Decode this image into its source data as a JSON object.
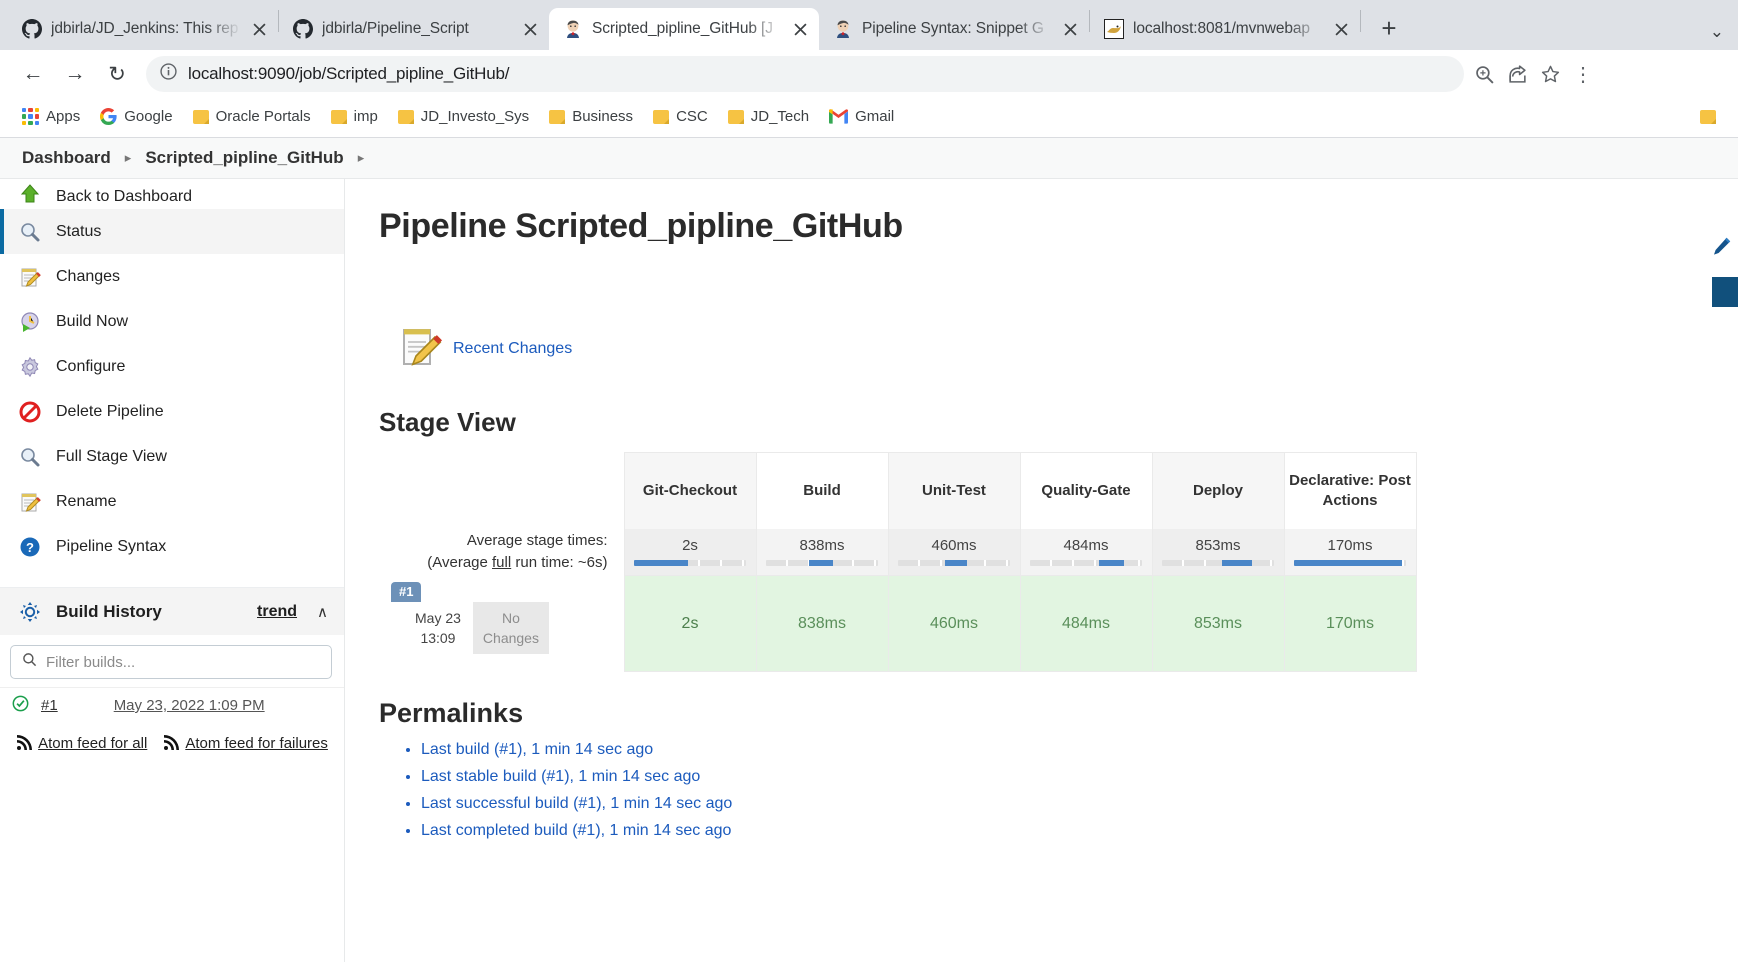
{
  "browser": {
    "tabs": [
      {
        "title": "jdbirla/JD_Jenkins: This rep",
        "favicon": "github-icon",
        "active": false
      },
      {
        "title": "jdbirla/Pipeline_Script",
        "favicon": "github-icon",
        "active": false
      },
      {
        "title": "Scripted_pipline_GitHub [J",
        "favicon": "jenkins-icon",
        "active": true
      },
      {
        "title": "Pipeline Syntax: Snippet G",
        "favicon": "jenkins-icon",
        "active": false
      },
      {
        "title": "localhost:8081/mvnwebap",
        "favicon": "tomcat-icon",
        "active": false
      }
    ],
    "new_tab_label": "+",
    "tab_list_caret": "⌄",
    "nav": {
      "back": "←",
      "forward": "→",
      "reload": "↻"
    },
    "omnibox": {
      "url": "localhost:9090/job/Scripted_pipline_GitHub/",
      "info_icon": "info-circle-icon",
      "zoom_icon": "zoom-search-icon",
      "share_icon": "share-icon",
      "star_icon": "bookmark-star-icon",
      "menu_icon": "kebab-menu-icon"
    },
    "bookmarks": [
      {
        "label": "Apps",
        "icon": "apps-grid-icon"
      },
      {
        "label": "Google",
        "icon": "google-g-icon"
      },
      {
        "label": "Oracle Portals",
        "icon": "folder-icon"
      },
      {
        "label": "imp",
        "icon": "folder-icon"
      },
      {
        "label": "JD_Investo_Sys",
        "icon": "folder-icon"
      },
      {
        "label": "Business",
        "icon": "folder-icon"
      },
      {
        "label": "CSC",
        "icon": "folder-icon"
      },
      {
        "label": "JD_Tech",
        "icon": "folder-icon"
      },
      {
        "label": "Gmail",
        "icon": "gmail-icon"
      }
    ]
  },
  "breadcrumb": {
    "items": [
      "Dashboard",
      "Scripted_pipline_GitHub"
    ],
    "separator": "▸",
    "trailing": "▸"
  },
  "sidebar": {
    "items": [
      {
        "label": "Back to Dashboard",
        "icon": "up-arrow-icon",
        "selected": false
      },
      {
        "label": "Status",
        "icon": "magnifier-icon",
        "selected": true
      },
      {
        "label": "Changes",
        "icon": "notepad-pencil-icon",
        "selected": false
      },
      {
        "label": "Build Now",
        "icon": "build-clock-icon",
        "selected": false
      },
      {
        "label": "Configure",
        "icon": "gear-icon",
        "selected": false
      },
      {
        "label": "Delete Pipeline",
        "icon": "no-entry-icon",
        "selected": false
      },
      {
        "label": "Full Stage View",
        "icon": "magnifier-icon",
        "selected": false
      },
      {
        "label": "Rename",
        "icon": "notepad-pencil-icon",
        "selected": false
      },
      {
        "label": "Pipeline Syntax",
        "icon": "help-question-icon",
        "selected": false
      }
    ],
    "build_history": {
      "title": "Build History",
      "icon": "build-history-icon",
      "trend_label": "trend",
      "collapse_caret": "∧",
      "filter_placeholder": "Filter builds...",
      "filter_value": "",
      "search_icon": "search-icon",
      "builds": [
        {
          "status_icon": "success-check-icon",
          "number": "#1",
          "date": "May 23, 2022 1:09 PM"
        }
      ],
      "feeds": [
        {
          "label": "Atom feed for all",
          "icon": "rss-icon"
        },
        {
          "label": "Atom feed for failures",
          "icon": "rss-icon"
        }
      ]
    }
  },
  "main": {
    "page_title": "Pipeline Scripted_pipline_GitHub",
    "recent_changes": {
      "label": "Recent Changes",
      "icon": "notepad-pencil-icon"
    },
    "stage_view_heading": "Stage View",
    "avg_label_line1": "Average stage times:",
    "avg_label_line2_pre": "(Average ",
    "avg_label_line2_underlined": "full",
    "avg_label_line2_post": " run time: ~6s)",
    "permalinks_heading": "Permalinks",
    "permalinks": [
      "Last build (#1), 1 min 14 sec ago",
      "Last stable build (#1), 1 min 14 sec ago",
      "Last successful build (#1), 1 min 14 sec ago",
      "Last completed build (#1), 1 min 14 sec ago"
    ],
    "right_rail": {
      "pencil_icon": "edit-pencil-icon",
      "block": "blue-panel-handle"
    }
  },
  "chart_data": {
    "type": "table",
    "title": "Stage View",
    "categories": [
      "Git-Checkout",
      "Build",
      "Unit-Test",
      "Quality-Gate",
      "Deploy",
      "Declarative: Post Actions"
    ],
    "series": [
      {
        "name": "Average stage times",
        "values": [
          "2s",
          "838ms",
          "460ms",
          "484ms",
          "853ms",
          "170ms"
        ],
        "bar_fractions": [
          0.48,
          0.27,
          0.33,
          0.38,
          0.43,
          0.96
        ]
      },
      {
        "name": "#1",
        "values": [
          "2s",
          "838ms",
          "460ms",
          "484ms",
          "853ms",
          "170ms"
        ]
      }
    ],
    "average_full_run_time": "~6s",
    "build_row": {
      "badge": "#1",
      "date_line1": "May 23",
      "date_line2": "13:09",
      "changes_line1": "No",
      "changes_line2": "Changes"
    }
  },
  "colors": {
    "accent_blue": "#1c5bbd",
    "stage_success_bg": "#e2f5e1",
    "stage_success_text": "#5a8f5a",
    "bar_fill": "#4a86c8",
    "badge_bg": "#6d91b8",
    "selected_rail": "#0b6aa2"
  }
}
